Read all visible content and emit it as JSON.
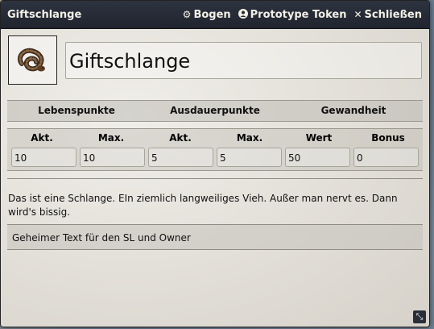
{
  "window": {
    "title": "Giftschlange",
    "buttons": [
      {
        "icon": "gear-icon",
        "glyph": "⚙",
        "label": "Bogen"
      },
      {
        "icon": "user-circle-icon",
        "glyph": "●",
        "label": "Prototype Token"
      },
      {
        "icon": "close-icon",
        "glyph": "✕",
        "label": "Schließen"
      }
    ]
  },
  "actor": {
    "name": "Giftschlange",
    "portrait_icon": "snake-icon"
  },
  "stats": {
    "groups": [
      "Lebenspunkte",
      "Ausdauerpunkte",
      "Gewandheit"
    ],
    "columns": [
      "Akt.",
      "Max.",
      "Akt.",
      "Max.",
      "Wert",
      "Bonus"
    ],
    "values": [
      "10",
      "10",
      "5",
      "5",
      "50",
      "0"
    ]
  },
  "description": "Das ist eine Schlange. EIn ziemlich langweiliges Vieh. Außer man nervt es. Dann wird's bissig.",
  "secret_text": "Geheimer Text für den SL und Owner",
  "colors": {
    "titlebar": "#23272f",
    "title_text": "#f2f0e6",
    "body": "#e3e0d9"
  }
}
